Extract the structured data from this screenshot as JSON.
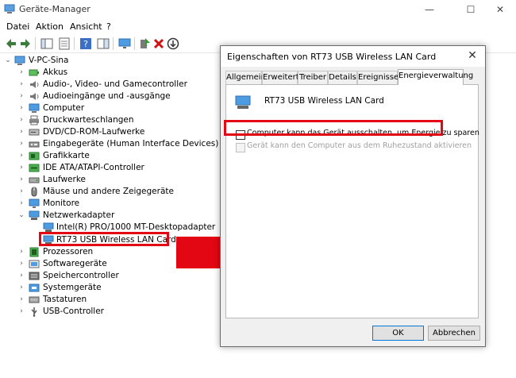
{
  "window": {
    "title": "Geräte-Manager",
    "minimize_glyph": "—",
    "maximize_glyph": "☐",
    "close_glyph": "✕"
  },
  "menu": {
    "items": [
      "Datei",
      "Aktion",
      "Ansicht",
      "?"
    ]
  },
  "toolbar": {
    "icons": [
      "back-icon",
      "forward-icon",
      "show-hide-console-tree-icon",
      "properties-icon",
      "help-icon",
      "action-pane-icon",
      "monitor-icon",
      "update-driver-icon",
      "uninstall-icon",
      "scan-hardware-icon"
    ]
  },
  "tree": {
    "root": "V-PC-Sina",
    "items": [
      {
        "label": "Akkus",
        "icon": "battery-icon",
        "expanded": false
      },
      {
        "label": "Audio-, Video- und Gamecontroller",
        "icon": "speaker-icon",
        "expanded": false
      },
      {
        "label": "Audioeingänge und -ausgänge",
        "icon": "speaker-icon",
        "expanded": false
      },
      {
        "label": "Computer",
        "icon": "computer-icon",
        "expanded": false
      },
      {
        "label": "Druckwarteschlangen",
        "icon": "printer-icon",
        "expanded": false
      },
      {
        "label": "DVD/CD-ROM-Laufwerke",
        "icon": "disc-drive-icon",
        "expanded": false
      },
      {
        "label": "Eingabegeräte (Human Interface Devices)",
        "icon": "hid-icon",
        "expanded": false
      },
      {
        "label": "Grafikkarte",
        "icon": "display-adapter-icon",
        "expanded": false
      },
      {
        "label": "IDE ATA/ATAPI-Controller",
        "icon": "ide-controller-icon",
        "expanded": false
      },
      {
        "label": "Laufwerke",
        "icon": "drive-icon",
        "expanded": false
      },
      {
        "label": "Mäuse und andere Zeigegeräte",
        "icon": "mouse-icon",
        "expanded": false
      },
      {
        "label": "Monitore",
        "icon": "monitor-icon",
        "expanded": false
      },
      {
        "label": "Netzwerkadapter",
        "icon": "network-adapter-icon",
        "expanded": true
      },
      {
        "label": "Intel(R) PRO/1000 MT-Desktopadapter",
        "icon": "network-adapter-icon",
        "child": true
      },
      {
        "label": "RT73 USB Wireless LAN Card",
        "icon": "network-adapter-icon",
        "child": true,
        "highlighted": true
      },
      {
        "label": "Prozessoren",
        "icon": "processor-icon",
        "expanded": false
      },
      {
        "label": "Softwaregeräte",
        "icon": "software-device-icon",
        "expanded": false
      },
      {
        "label": "Speichercontroller",
        "icon": "storage-controller-icon",
        "expanded": false
      },
      {
        "label": "Systemgeräte",
        "icon": "system-device-icon",
        "expanded": false
      },
      {
        "label": "Tastaturen",
        "icon": "keyboard-icon",
        "expanded": false
      },
      {
        "label": "USB-Controller",
        "icon": "usb-icon",
        "expanded": false
      }
    ]
  },
  "dialog": {
    "title": "Eigenschaften von RT73 USB Wireless LAN Card",
    "close_glyph": "✕",
    "tabs": [
      "Allgemein",
      "Erweitert",
      "Treiber",
      "Details",
      "Ereignisse",
      "Energieverwaltung"
    ],
    "active_tab": "Energieverwaltung",
    "device_name": "RT73 USB Wireless LAN Card",
    "option1": {
      "label": "Computer kann das Gerät ausschalten, um Energie zu sparen",
      "checked": false,
      "enabled": true
    },
    "option2": {
      "label": "Gerät kann den Computer aus dem Ruhezustand aktivieren",
      "checked": false,
      "enabled": false
    },
    "ok_label": "OK",
    "cancel_label": "Abbrechen"
  },
  "colors": {
    "highlight": "#e30613",
    "folder_blue": "#2b88d8",
    "disabled_text": "#a0a0a0"
  }
}
